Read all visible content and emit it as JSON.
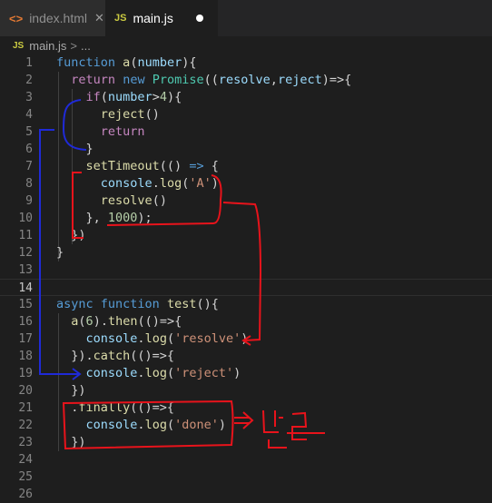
{
  "tabs": [
    {
      "icon": "<>",
      "label": "index.html",
      "close": "✕"
    },
    {
      "icon": "JS",
      "label": "main.js"
    }
  ],
  "breadcrumb": {
    "icon": "JS",
    "file": "main.js",
    "sep": ">",
    "rest": "..."
  },
  "lines": [
    {
      "n": "1",
      "code": [
        [
          "k",
          "function"
        ],
        [
          "p",
          " "
        ],
        [
          "f",
          "a"
        ],
        [
          "p",
          "("
        ],
        [
          "v",
          "number"
        ],
        [
          "p",
          "){"
        ]
      ]
    },
    {
      "n": "2",
      "code": [
        [
          "p",
          "  "
        ],
        [
          "kc",
          "return"
        ],
        [
          "p",
          " "
        ],
        [
          "k",
          "new"
        ],
        [
          "p",
          " "
        ],
        [
          "c",
          "Promise"
        ],
        [
          "p",
          "(("
        ],
        [
          "v",
          "resolve"
        ],
        [
          "p",
          ","
        ],
        [
          "v",
          "reject"
        ],
        [
          "p",
          ")=>{"
        ]
      ]
    },
    {
      "n": "3",
      "code": [
        [
          "p",
          "    "
        ],
        [
          "kc",
          "if"
        ],
        [
          "p",
          "("
        ],
        [
          "v",
          "number"
        ],
        [
          "p",
          ">"
        ],
        [
          "n",
          "4"
        ],
        [
          "p",
          "){"
        ]
      ]
    },
    {
      "n": "4",
      "code": [
        [
          "p",
          "      "
        ],
        [
          "f",
          "reject"
        ],
        [
          "p",
          "()"
        ]
      ]
    },
    {
      "n": "5",
      "code": [
        [
          "p",
          "      "
        ],
        [
          "kc",
          "return"
        ]
      ]
    },
    {
      "n": "6",
      "code": [
        [
          "p",
          "    }"
        ]
      ]
    },
    {
      "n": "7",
      "code": [
        [
          "p",
          "    "
        ],
        [
          "f",
          "setTimeout"
        ],
        [
          "p",
          "(() "
        ],
        [
          "k",
          "=>"
        ],
        [
          "p",
          " {"
        ]
      ]
    },
    {
      "n": "8",
      "code": [
        [
          "p",
          "      "
        ],
        [
          "v",
          "console"
        ],
        [
          "p",
          "."
        ],
        [
          "f",
          "log"
        ],
        [
          "p",
          "("
        ],
        [
          "s",
          "'A'"
        ],
        [
          "p",
          ")"
        ]
      ]
    },
    {
      "n": "9",
      "code": [
        [
          "p",
          "      "
        ],
        [
          "f",
          "resolve"
        ],
        [
          "p",
          "()"
        ]
      ]
    },
    {
      "n": "10",
      "code": [
        [
          "p",
          "    }, "
        ],
        [
          "n",
          "1000"
        ],
        [
          "p",
          ");"
        ]
      ]
    },
    {
      "n": "11",
      "code": [
        [
          "p",
          "  })"
        ]
      ]
    },
    {
      "n": "12",
      "code": [
        [
          "p",
          "}"
        ]
      ]
    },
    {
      "n": "13",
      "code": []
    },
    {
      "n": "14",
      "code": []
    },
    {
      "n": "15",
      "code": [
        [
          "k",
          "async"
        ],
        [
          "p",
          " "
        ],
        [
          "k",
          "function"
        ],
        [
          "p",
          " "
        ],
        [
          "f",
          "test"
        ],
        [
          "p",
          "(){"
        ]
      ]
    },
    {
      "n": "16",
      "code": [
        [
          "p",
          "  "
        ],
        [
          "f",
          "a"
        ],
        [
          "p",
          "("
        ],
        [
          "n",
          "6"
        ],
        [
          "p",
          ")."
        ],
        [
          "f",
          "then"
        ],
        [
          "p",
          "(()=>{"
        ]
      ]
    },
    {
      "n": "17",
      "code": [
        [
          "p",
          "    "
        ],
        [
          "v",
          "console"
        ],
        [
          "p",
          "."
        ],
        [
          "f",
          "log"
        ],
        [
          "p",
          "("
        ],
        [
          "s",
          "'resolve'"
        ],
        [
          "p",
          ")"
        ]
      ]
    },
    {
      "n": "18",
      "code": [
        [
          "p",
          "  })."
        ],
        [
          "f",
          "catch"
        ],
        [
          "p",
          "(()=>{"
        ]
      ]
    },
    {
      "n": "19",
      "code": [
        [
          "p",
          "    "
        ],
        [
          "v",
          "console"
        ],
        [
          "p",
          "."
        ],
        [
          "f",
          "log"
        ],
        [
          "p",
          "("
        ],
        [
          "s",
          "'reject'"
        ],
        [
          "p",
          ")"
        ]
      ]
    },
    {
      "n": "20",
      "code": [
        [
          "p",
          "  })"
        ]
      ]
    },
    {
      "n": "21",
      "code": [
        [
          "p",
          "  ."
        ],
        [
          "f",
          "finally"
        ],
        [
          "p",
          "(()=>{"
        ]
      ]
    },
    {
      "n": "22",
      "code": [
        [
          "p",
          "    "
        ],
        [
          "v",
          "console"
        ],
        [
          "p",
          "."
        ],
        [
          "f",
          "log"
        ],
        [
          "p",
          "("
        ],
        [
          "s",
          "'done'"
        ],
        [
          "p",
          ")"
        ]
      ]
    },
    {
      "n": "23",
      "code": [
        [
          "p",
          "  })"
        ]
      ]
    },
    {
      "n": "24",
      "code": []
    },
    {
      "n": "25",
      "code": []
    },
    {
      "n": "26",
      "code": []
    }
  ],
  "active_line": "14",
  "colors": {
    "annotation_red": "#e8131b",
    "annotation_blue": "#1f2ad8"
  }
}
